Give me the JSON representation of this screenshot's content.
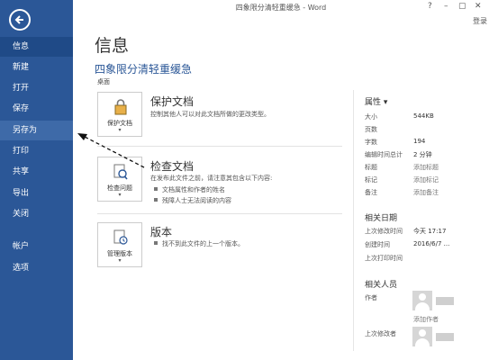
{
  "window": {
    "title": "四象限分清轻重缓急 - Word",
    "help": "?",
    "minimize": "–",
    "restore": "▢",
    "close": "✕",
    "login": "登录"
  },
  "sidebar": {
    "items": [
      {
        "label": "信息"
      },
      {
        "label": "新建"
      },
      {
        "label": "打开"
      },
      {
        "label": "保存"
      },
      {
        "label": "另存为"
      },
      {
        "label": "打印"
      },
      {
        "label": "共享"
      },
      {
        "label": "导出"
      },
      {
        "label": "关闭"
      },
      {
        "label": "帐户"
      },
      {
        "label": "选项"
      }
    ]
  },
  "main": {
    "page_title": "信息",
    "doc_title": "四象限分清轻重缓急",
    "doc_path": "桌面",
    "protect": {
      "tile_label": "保护文档",
      "title": "保护文档",
      "desc": "控制其他人可以对此文档所做的更改类型。"
    },
    "inspect": {
      "tile_label": "检查问题",
      "title": "检查文档",
      "desc": "在发布此文件之前，请注意其包含以下内容:",
      "bullets": [
        "文档属性和作者的姓名",
        "残障人士无法阅读的内容"
      ]
    },
    "versions": {
      "tile_label": "管理版本",
      "title": "版本",
      "desc": "找不到此文件的上一个版本。"
    },
    "caret": "▾"
  },
  "properties": {
    "heading": "属性 ▾",
    "rows": [
      {
        "label": "大小",
        "value": "544KB"
      },
      {
        "label": "页数",
        "value": ""
      },
      {
        "label": "字数",
        "value": "194"
      },
      {
        "label": "编辑时间总计",
        "value": "2 分钟"
      },
      {
        "label": "标题",
        "value": "添加标题"
      },
      {
        "label": "标记",
        "value": "添加标记"
      },
      {
        "label": "备注",
        "value": "添加备注"
      }
    ],
    "dates_heading": "相关日期",
    "dates": [
      {
        "label": "上次修改时间",
        "value": "今天 17:17"
      },
      {
        "label": "创建时间",
        "value": "2016/6/7 ..."
      },
      {
        "label": "上次打印时间",
        "value": ""
      }
    ],
    "people_heading": "相关人员",
    "author_label": "作者",
    "add_author": "添加作者",
    "last_modified_by_label": "上次修改者"
  },
  "colors": {
    "sidebar": "#2b5797",
    "accent": "#2b5797"
  }
}
